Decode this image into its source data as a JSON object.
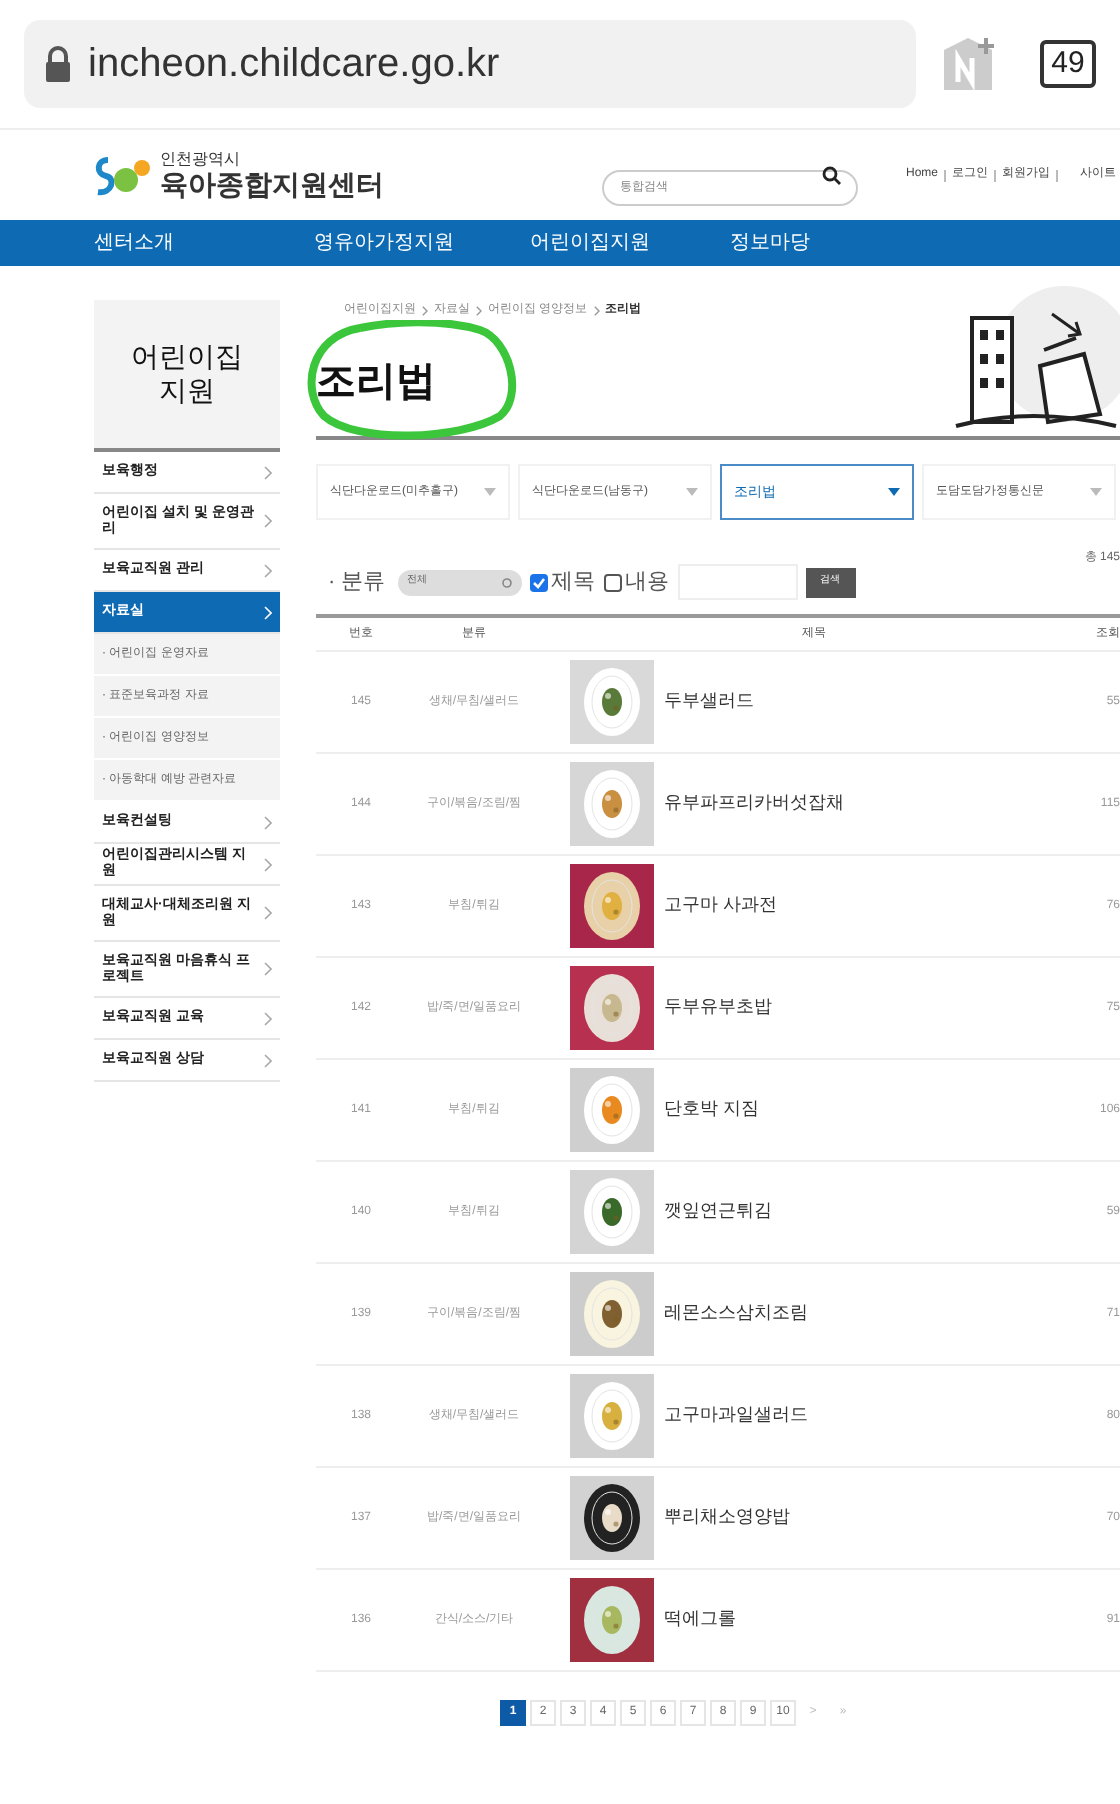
{
  "browser": {
    "url": "incheon.childcare.go.kr",
    "tab_count": "49"
  },
  "header": {
    "logo_small": "인천광역시",
    "logo_big": "육아종합지원센터",
    "search": {
      "placeholder": "통합검색"
    },
    "links": [
      "Home",
      "로그인",
      "회원가입",
      "사이트"
    ]
  },
  "nav": [
    "센터소개",
    "영유아가정지원",
    "어린이집지원",
    "정보마당"
  ],
  "sidebar": {
    "title": "어린이집 지원",
    "items": [
      {
        "label": "보육행정",
        "kind": "main",
        "selected": false
      },
      {
        "label": "어린이집 설치 및 운영관리",
        "kind": "main",
        "selected": false
      },
      {
        "label": "보육교직원 관리",
        "kind": "main",
        "selected": false
      },
      {
        "label": "자료실",
        "kind": "main",
        "selected": true
      },
      {
        "label": "· 어린이집 운영자료",
        "kind": "sub",
        "selected": false
      },
      {
        "label": "· 표준보육과정 자료",
        "kind": "sub",
        "selected": false
      },
      {
        "label": "· 어린이집 영양정보",
        "kind": "sub",
        "selected": false
      },
      {
        "label": "· 아동학대 예방 관련자료",
        "kind": "sub",
        "selected": false
      },
      {
        "label": "보육컨설팅",
        "kind": "main",
        "selected": false
      },
      {
        "label": "어린이집관리시스템 지원",
        "kind": "main",
        "selected": false
      },
      {
        "label": "대체교사·대체조리원 지원",
        "kind": "main",
        "selected": false
      },
      {
        "label": "보육교직원 마음휴식 프로젝트",
        "kind": "main",
        "selected": false
      },
      {
        "label": "보육교직원 교육",
        "kind": "main",
        "selected": false
      },
      {
        "label": "보육교직원 상담",
        "kind": "main",
        "selected": false
      }
    ]
  },
  "breadcrumb": [
    "어린이집지원",
    "자료실",
    "어린이집 영양정보",
    "조리법"
  ],
  "page_title": "조리법",
  "category_tabs": [
    {
      "label": "식단다운로드(미추홀구)",
      "selected": false
    },
    {
      "label": "식단다운로드(남동구)",
      "selected": false
    },
    {
      "label": "조리법",
      "selected": true
    },
    {
      "label": "도담도담가정통신문",
      "selected": false
    }
  ],
  "filter": {
    "label": "· 분류",
    "category": "전체",
    "title_label": "제목",
    "title_checked": true,
    "content_label": "내용",
    "content_checked": false,
    "button": "검색",
    "total": "총 145"
  },
  "table": {
    "columns": [
      "번호",
      "분류",
      "제목",
      "조회"
    ],
    "rows": [
      {
        "no": "145",
        "category": "생채/무침/샐러드",
        "title": "두부샐러드",
        "views": "55"
      },
      {
        "no": "144",
        "category": "구이/볶음/조림/찜",
        "title": "유부파프리카버섯잡채",
        "views": "115"
      },
      {
        "no": "143",
        "category": "부침/튀김",
        "title": "고구마 사과전",
        "views": "76"
      },
      {
        "no": "142",
        "category": "밥/죽/면/일품요리",
        "title": "두부유부초밥",
        "views": "75"
      },
      {
        "no": "141",
        "category": "부침/튀김",
        "title": "단호박 지짐",
        "views": "106"
      },
      {
        "no": "140",
        "category": "부침/튀김",
        "title": "깻잎연근튀김",
        "views": "59"
      },
      {
        "no": "139",
        "category": "구이/볶음/조림/찜",
        "title": "레몬소스삼치조림",
        "views": "71"
      },
      {
        "no": "138",
        "category": "생채/무침/샐러드",
        "title": "고구마과일샐러드",
        "views": "80"
      },
      {
        "no": "137",
        "category": "밥/죽/면/일품요리",
        "title": "뿌리채소영양밥",
        "views": "70"
      },
      {
        "no": "136",
        "category": "간식/소스/기타",
        "title": "떡에그롤",
        "views": "91"
      }
    ]
  },
  "pagination": {
    "pages": [
      {
        "label": "1",
        "selected": true
      },
      {
        "label": "2",
        "selected": false
      },
      {
        "label": "3",
        "selected": false
      },
      {
        "label": "4",
        "selected": false
      },
      {
        "label": "5",
        "selected": false
      },
      {
        "label": "6",
        "selected": false
      },
      {
        "label": "7",
        "selected": false
      },
      {
        "label": "8",
        "selected": false
      },
      {
        "label": "9",
        "selected": false
      },
      {
        "label": "10",
        "selected": false
      }
    ],
    "next": ">",
    "last": "»"
  }
}
